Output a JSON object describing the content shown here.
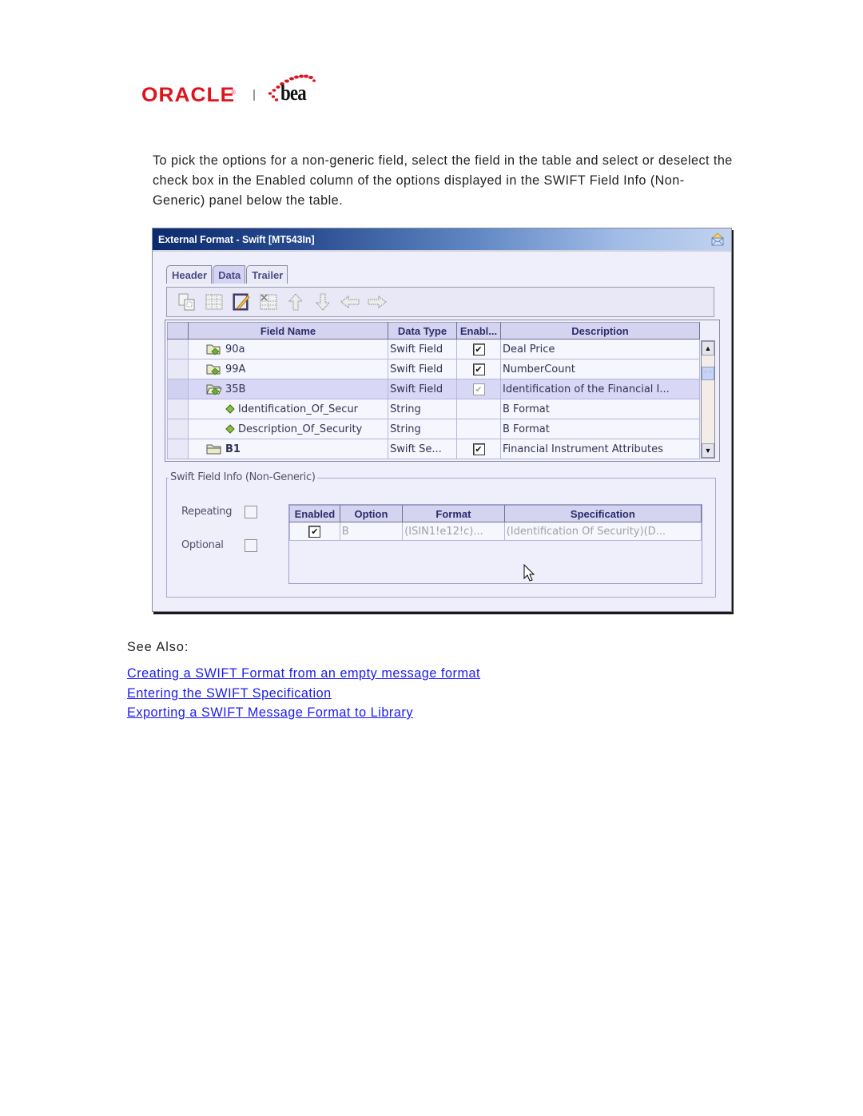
{
  "logo": {
    "oracle": "ORACLE",
    "bea": "bea"
  },
  "intro": "To pick the options for a non-generic field, select the field in the table and select or deselect the check box in the Enabled column of the options displayed in the SWIFT Field Info (Non-Generic) panel below the table.",
  "window": {
    "title": "External Format - Swift [MT543In]",
    "title_icon": "envelope-icon",
    "tabs": [
      {
        "label": "Header",
        "active": false
      },
      {
        "label": "Data",
        "active": true
      },
      {
        "label": "Trailer",
        "active": false
      }
    ],
    "toolbar": [
      {
        "name": "copy-icon"
      },
      {
        "name": "insert-row-icon"
      },
      {
        "name": "edit-icon"
      },
      {
        "name": "delete-row-icon"
      },
      {
        "name": "move-up-icon"
      },
      {
        "name": "move-down-icon"
      },
      {
        "name": "move-left-icon"
      },
      {
        "name": "move-right-icon"
      }
    ],
    "grid": {
      "columns": [
        "Field Name",
        "Data Type",
        "Enabl...",
        "Description"
      ],
      "rows": [
        {
          "name": "90a",
          "type": "Swift Field",
          "enabled": "checked",
          "description": "Deal Price",
          "level": 1,
          "icon": "folder-field-icon",
          "selected": false,
          "bold": false
        },
        {
          "name": "99A",
          "type": "Swift Field",
          "enabled": "checked",
          "description": "NumberCount",
          "level": 1,
          "icon": "folder-field-icon",
          "selected": false,
          "bold": false
        },
        {
          "name": "35B",
          "type": "Swift Field",
          "enabled": "disabled-checked",
          "description": "Identification of the Financial I...",
          "level": 1,
          "icon": "folder-open-field-icon",
          "selected": true,
          "bold": false
        },
        {
          "name": "Identification_Of_Secur",
          "type": "String",
          "enabled": "",
          "description": "B Format",
          "level": 2,
          "icon": "diamond-icon",
          "selected": false,
          "bold": false
        },
        {
          "name": "Description_Of_Security",
          "type": "String",
          "enabled": "",
          "description": "B Format",
          "level": 2,
          "icon": "diamond-icon",
          "selected": false,
          "bold": false
        },
        {
          "name": "B1",
          "type": "Swift Se...",
          "enabled": "checked",
          "description": "Financial Instrument Attributes",
          "level": 1,
          "icon": "folder-icon",
          "selected": false,
          "bold": true
        }
      ]
    },
    "field_info": {
      "title": "Swift Field Info (Non-Generic)",
      "repeating_label": "Repeating",
      "repeating_checked": false,
      "optional_label": "Optional",
      "optional_checked": false,
      "columns": [
        "Enabled",
        "Option",
        "Format",
        "Specification"
      ],
      "rows": [
        {
          "enabled": "checked",
          "option": "B",
          "format": "(ISIN1!e12!c)...",
          "specification": "(Identification Of Security)(D..."
        }
      ]
    }
  },
  "see_also": {
    "label": "See Also:",
    "links": [
      "Creating a SWIFT Format from an empty message format",
      "Entering the SWIFT Specification",
      "Exporting a SWIFT Message Format to Library"
    ]
  },
  "colors": {
    "link": "#1a1aee",
    "oracle_red": "#e0121a",
    "title_gradient_start": "#0c2a6e",
    "panel_bg": "#efeffc",
    "header_bg": "#d4d4f0"
  }
}
